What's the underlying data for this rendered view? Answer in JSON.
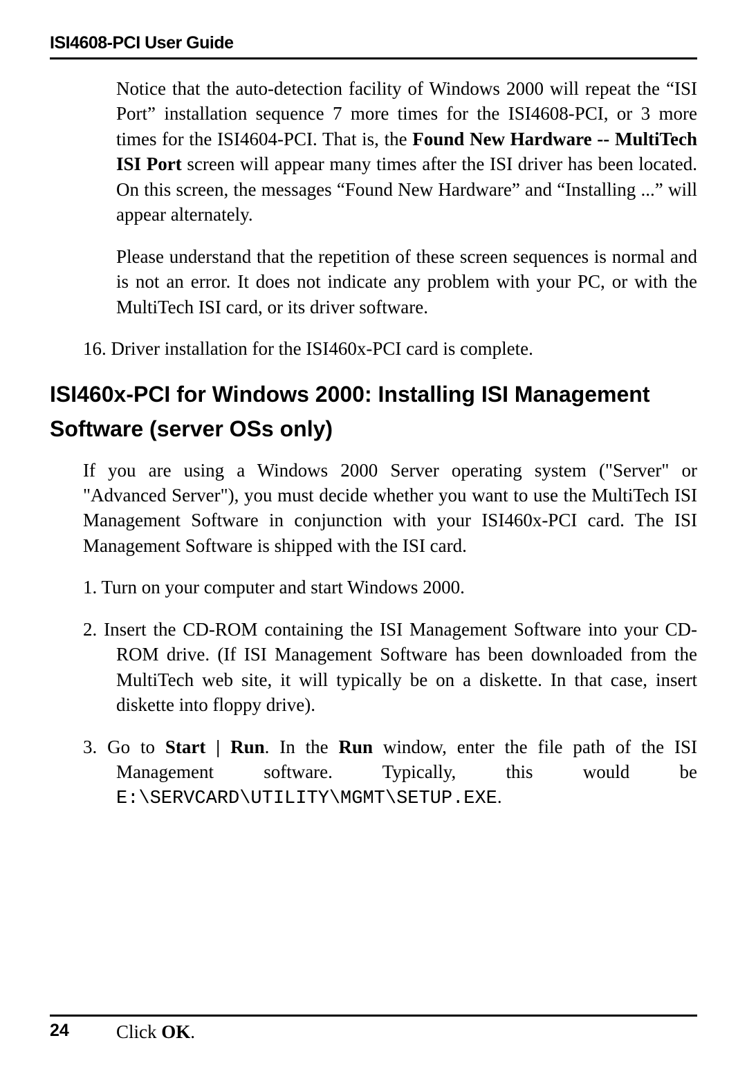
{
  "header": {
    "title": "ISI4608-PCI User Guide"
  },
  "paragraphs": {
    "p1_a": "Notice that the auto-detection facility of Windows 2000 will repeat the “ISI Port” installation sequence 7 more times for the ISI4608-PCI,  or 3 more times for the ISI4604-PCI.   That is, the ",
    "p1_bold": "Found New Hardware -- MultiTech ISI Port",
    "p1_b": " screen will appear many times after the ISI driver has been located.  On this screen, the messages “Found New Hardware” and “Installing ...” will appear alternately.",
    "p2": "Please understand that the repetition of these screen sequences is normal and is not an error.  It does not indicate any problem with your PC, or with the MultiTech ISI card, or its driver software.",
    "p3": "16.  Driver installation for the ISI460x-PCI  card is complete."
  },
  "section_heading": "ISI460x-PCI for Windows 2000: Installing ISI Management Software (server OSs only)",
  "intro": "If you are using a Windows 2000 Server operating system (\"Server\" or \"Advanced Server\"), you must decide whether you want to use the MultiTech ISI Management Software in conjunction with your ISI460x-PCI  card.  The ISI Management Software is shipped with the ISI card.",
  "steps": {
    "s1": "1. Turn on your computer and start Windows 2000.",
    "s2": "2.  Insert the CD-ROM containing the ISI Management Software into your CD-ROM drive.  (If ISI Management Software has been downloaded from the MultiTech web site, it will typically be on a diskette.  In that case, insert diskette into floppy drive).",
    "s3_a": "3. Go to ",
    "s3_bold1": "Start | Run",
    "s3_b": ". In the ",
    "s3_bold2": "Run",
    "s3_c": " window, enter the file path of the ISI Management software.  Typically, this would be ",
    "s3_mono": "E:\\SERVCARD\\UTILITY\\MGMT\\SETUP.EXE",
    "s3_d": "."
  },
  "click_a": "Click ",
  "click_bold": "OK",
  "click_b": ".",
  "page_number": "24"
}
